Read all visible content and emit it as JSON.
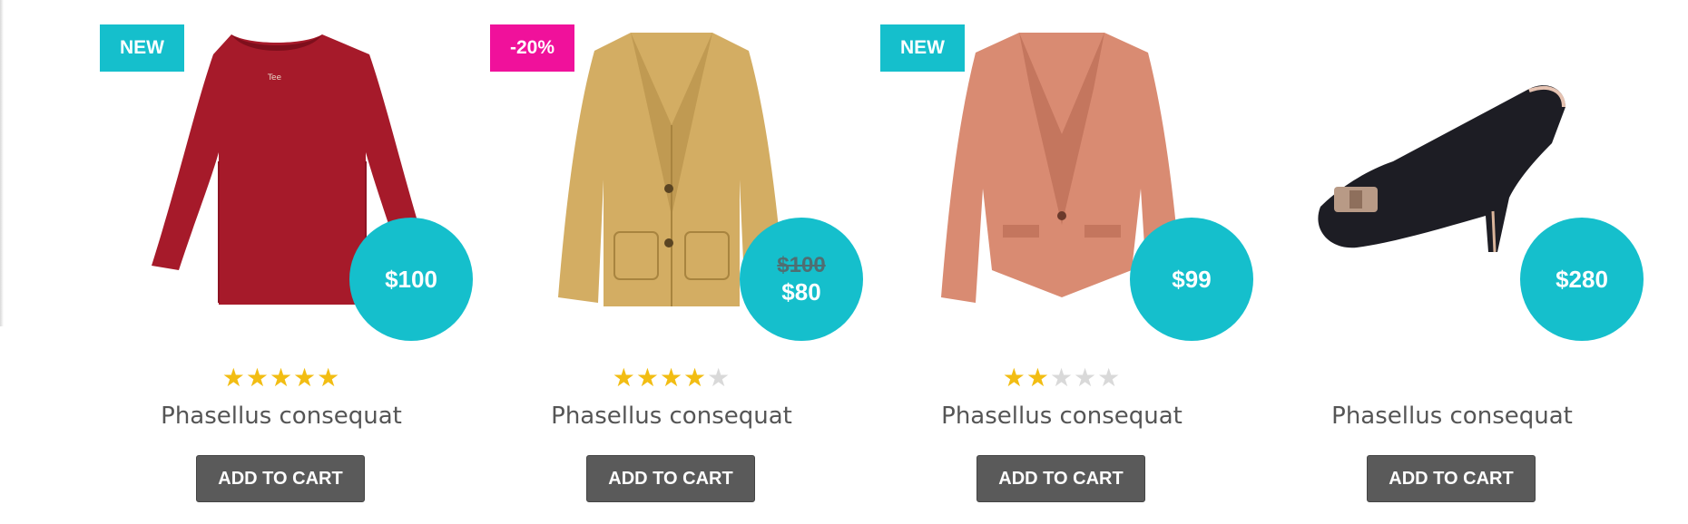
{
  "colors": {
    "accent": "#15bfcc",
    "sale": "#f0119b",
    "star_on": "#f2bd13",
    "star_off": "#d9d9d9",
    "button": "#5a5a5a"
  },
  "products": [
    {
      "badge": "NEW",
      "badge_type": "new",
      "image": "red-long-sleeve-shirt",
      "price": "$100",
      "old_price": "",
      "rating": 5,
      "title": "Phasellus consequat",
      "button_label": "ADD TO CART"
    },
    {
      "badge": "-20%",
      "badge_type": "sale",
      "image": "tan-blazer",
      "price": "$80",
      "old_price": "$100",
      "rating": 4,
      "title": "Phasellus consequat",
      "button_label": "ADD TO CART"
    },
    {
      "badge": "NEW",
      "badge_type": "new",
      "image": "salmon-blazer",
      "price": "$99",
      "old_price": "",
      "rating": 2,
      "title": "Phasellus consequat",
      "button_label": "ADD TO CART"
    },
    {
      "badge": "",
      "badge_type": "",
      "image": "black-high-heel",
      "price": "$280",
      "old_price": "",
      "rating": 0,
      "title": "Phasellus consequat",
      "button_label": "ADD TO CART"
    }
  ]
}
